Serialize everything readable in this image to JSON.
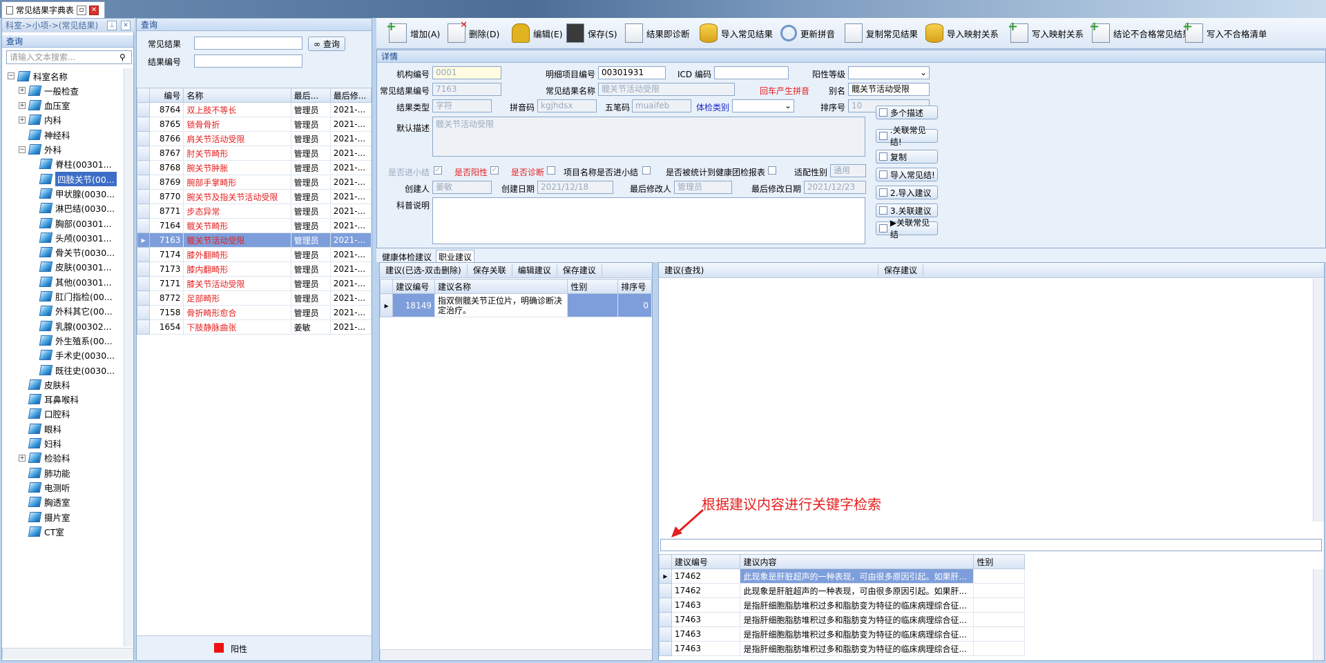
{
  "window": {
    "tab_title": "常见结果字典表"
  },
  "left": {
    "breadcrumb": "科室->小项->(常见结果)",
    "query_header": "查询",
    "search_placeholder": "请输入文本搜索...",
    "tree": [
      {
        "label": "科室名称",
        "level": 0,
        "exp": "−"
      },
      {
        "label": "一般检查",
        "level": 1,
        "exp": "+"
      },
      {
        "label": "血压室",
        "level": 1,
        "exp": "+"
      },
      {
        "label": "内科",
        "level": 1,
        "exp": "+"
      },
      {
        "label": "神经科",
        "level": 1,
        "exp": ""
      },
      {
        "label": "外科",
        "level": 1,
        "exp": "−"
      },
      {
        "label": "脊柱(00301...",
        "level": 2,
        "exp": ""
      },
      {
        "label": "四肢关节(00...",
        "level": 2,
        "exp": "",
        "selected": true
      },
      {
        "label": "甲状腺(0030...",
        "level": 2,
        "exp": ""
      },
      {
        "label": "淋巴结(0030...",
        "level": 2,
        "exp": ""
      },
      {
        "label": "胸部(00301...",
        "level": 2,
        "exp": ""
      },
      {
        "label": "头颅(00301...",
        "level": 2,
        "exp": ""
      },
      {
        "label": "骨关节(0030...",
        "level": 2,
        "exp": ""
      },
      {
        "label": "皮肤(00301...",
        "level": 2,
        "exp": ""
      },
      {
        "label": "其他(00301...",
        "level": 2,
        "exp": ""
      },
      {
        "label": "肛门指检(00...",
        "level": 2,
        "exp": ""
      },
      {
        "label": "外科其它(00...",
        "level": 2,
        "exp": ""
      },
      {
        "label": "乳腺(00302...",
        "level": 2,
        "exp": ""
      },
      {
        "label": "外生殖系(00...",
        "level": 2,
        "exp": ""
      },
      {
        "label": "手术史(0030...",
        "level": 2,
        "exp": ""
      },
      {
        "label": "既往史(0030...",
        "level": 2,
        "exp": ""
      },
      {
        "label": "皮肤科",
        "level": 1,
        "exp": ""
      },
      {
        "label": "耳鼻喉科",
        "level": 1,
        "exp": ""
      },
      {
        "label": "口腔科",
        "level": 1,
        "exp": ""
      },
      {
        "label": "眼科",
        "level": 1,
        "exp": ""
      },
      {
        "label": "妇科",
        "level": 1,
        "exp": ""
      },
      {
        "label": "检验科",
        "level": 1,
        "exp": "+"
      },
      {
        "label": "肺功能",
        "level": 1,
        "exp": ""
      },
      {
        "label": "电测听",
        "level": 1,
        "exp": ""
      },
      {
        "label": "胸透室",
        "level": 1,
        "exp": ""
      },
      {
        "label": "摄片室",
        "level": 1,
        "exp": ""
      },
      {
        "label": "CT室",
        "level": 1,
        "exp": ""
      }
    ]
  },
  "mid": {
    "header": "查询",
    "label_result": "常见结果",
    "label_code": "结果编号",
    "query_button": "查询",
    "columns": [
      "编号",
      "名称",
      "最后...",
      "最后修..."
    ],
    "rows": [
      {
        "id": "8764",
        "name": "双上肢不等长",
        "by": "管理员",
        "date": "2021-..."
      },
      {
        "id": "8765",
        "name": "锁骨骨折",
        "by": "管理员",
        "date": "2021-..."
      },
      {
        "id": "8766",
        "name": "肩关节活动受限",
        "by": "管理员",
        "date": "2021-..."
      },
      {
        "id": "8767",
        "name": "肘关节畸形",
        "by": "管理员",
        "date": "2021-..."
      },
      {
        "id": "8768",
        "name": "腕关节肿胀",
        "by": "管理员",
        "date": "2021-..."
      },
      {
        "id": "8769",
        "name": "腕部手掌畸形",
        "by": "管理员",
        "date": "2021-..."
      },
      {
        "id": "8770",
        "name": "腕关节及指关节活动受限",
        "by": "管理员",
        "date": "2021-..."
      },
      {
        "id": "8771",
        "name": "步态异常",
        "by": "管理员",
        "date": "2021-..."
      },
      {
        "id": "7164",
        "name": "髋关节畸形",
        "by": "管理员",
        "date": "2021-..."
      },
      {
        "id": "7163",
        "name": "髋关节活动受限",
        "by": "管理员",
        "date": "2021-...",
        "selected": true
      },
      {
        "id": "7174",
        "name": "膝外翻畸形",
        "by": "管理员",
        "date": "2021-..."
      },
      {
        "id": "7173",
        "name": "膝内翻畸形",
        "by": "管理员",
        "date": "2021-..."
      },
      {
        "id": "7171",
        "name": "膝关节活动受限",
        "by": "管理员",
        "date": "2021-..."
      },
      {
        "id": "8772",
        "name": "足部畸形",
        "by": "管理员",
        "date": "2021-..."
      },
      {
        "id": "7158",
        "name": "骨折畸形愈合",
        "by": "管理员",
        "date": "2021-..."
      },
      {
        "id": "1654",
        "name": "下肢静脉曲张",
        "by": "姜敏",
        "date": "2021-..."
      }
    ],
    "legend": "阳性",
    "legend_color": "#ee1111"
  },
  "toolbar": [
    {
      "label": "增加(A)",
      "icon": "add-doc-icon",
      "cls": "plus"
    },
    {
      "label": "删除(D)",
      "icon": "delete-doc-icon",
      "cls": "x"
    },
    {
      "label": "编辑(E)",
      "icon": "lock-icon",
      "cls": "lock"
    },
    {
      "label": "保存(S)",
      "icon": "save-icon",
      "cls": "save"
    },
    {
      "label": "结果即诊断",
      "icon": "doc-icon",
      "cls": ""
    },
    {
      "label": "导入常见结果",
      "icon": "database-icon",
      "cls": "db"
    },
    {
      "label": "更新拼音",
      "icon": "refresh-icon",
      "cls": "refresh"
    },
    {
      "label": "复制常见结果",
      "icon": "copy-doc-icon",
      "cls": ""
    },
    {
      "label": "导入映射关系",
      "icon": "database-icon",
      "cls": "db"
    },
    {
      "label": "写入映射关系",
      "icon": "add-doc-icon",
      "cls": "plus"
    },
    {
      "label": "结论不合格常见结果",
      "icon": "add-doc-icon",
      "cls": "plus"
    },
    {
      "label": "写入不合格清单",
      "icon": "add-doc-icon",
      "cls": "plus"
    }
  ],
  "detail": {
    "header": "详情",
    "org_label": "机构编号",
    "org_value": "0001",
    "item_label": "明细项目编号",
    "item_value": "00301931",
    "icd_label": "ICD 编码",
    "icd_value": "",
    "positive_label": "阳性等级",
    "code_label": "常见结果编号",
    "code_value": "7163",
    "name_label": "常见结果名称",
    "name_value": "髋关节活动受限",
    "enter_pinyin": "回车产生拼音",
    "alias_label": "别名",
    "alias_value": "髋关节活动受限",
    "type_label": "结果类型",
    "type_value": "字符",
    "pinyin_label": "拼音码",
    "pinyin_value": "kgjhdsx",
    "wubi_label": "五笔码",
    "wubi_value": "muaifeb",
    "exam_label": "体检类别",
    "sort_label": "排序号",
    "sort_value": "10",
    "default_label": "默认描述",
    "default_value": "髋关节活动受限",
    "summary_label": "是否进小结",
    "positive_chk_label": "是否阳性",
    "diagnosis_label": "是否诊断",
    "item_name_label": "项目名称是否进小结",
    "stat_label": "是否被统计到健康团检报表",
    "gender_label": "适配性别",
    "gender_value": "通用",
    "creator_label": "创建人",
    "creator_value": "姜敏",
    "created_label": "创建日期",
    "created_value": "2021/12/18",
    "modifier_label": "最后修改人",
    "modifier_value": "管理员",
    "modified_label": "最后修改日期",
    "modified_value": "2021/12/23",
    "science_label": "科普说明",
    "side_buttons": [
      "多个描述",
      ".关联常见结!",
      "复制",
      "导入常见结!",
      "2.导入建议",
      "3.关联建议",
      "▶关联常见结"
    ]
  },
  "tabs": [
    "健康体检建议",
    "职业建议"
  ],
  "bottom_left": {
    "toolbar": [
      "建议(已选-双击删除)",
      "保存关联",
      "编辑建议",
      "保存建议"
    ],
    "columns": [
      "建议编号",
      "建议名称",
      "性别",
      "排序号"
    ],
    "rows": [
      {
        "id": "18149",
        "name": "指双侧髋关节正位片，明确诊断决定治疗。",
        "gender": "",
        "order": "0"
      }
    ]
  },
  "bottom_right": {
    "toolbar": [
      "建议(查找)",
      "保存建议"
    ],
    "annotation": "根据建议内容进行关键字检索",
    "columns": [
      "建议编号",
      "建议内容",
      "性别"
    ],
    "rows": [
      {
        "id": "17462",
        "content": "此现象是肝脏超声的一种表现，可由很多原因引起。如果肝..."
      },
      {
        "id": "17462",
        "content": "此现象是肝脏超声的一种表现，可由很多原因引起。如果肝..."
      },
      {
        "id": "17463",
        "content": "是指肝细胞脂肪堆积过多和脂肪变为特征的临床病理综合征..."
      },
      {
        "id": "17463",
        "content": "是指肝细胞脂肪堆积过多和脂肪变为特征的临床病理综合征..."
      },
      {
        "id": "17463",
        "content": "是指肝细胞脂肪堆积过多和脂肪变为特征的临床病理综合征..."
      },
      {
        "id": "17463",
        "content": "是指肝细胞脂肪堆积过多和脂肪变为特征的临床病理综合征..."
      }
    ]
  }
}
